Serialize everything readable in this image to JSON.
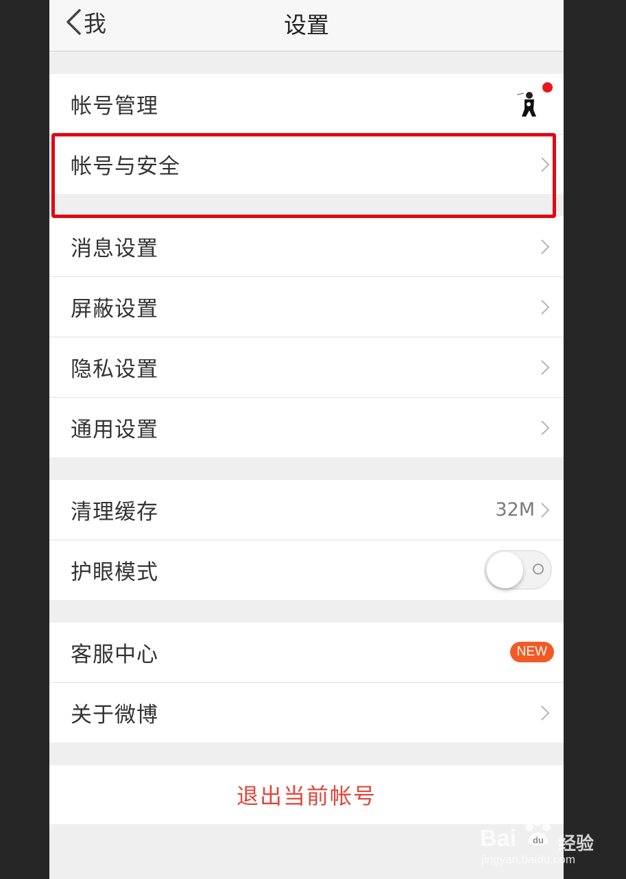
{
  "navbar": {
    "back_label": "我",
    "title": "设置"
  },
  "groups": {
    "account": [
      {
        "label": "帐号管理"
      },
      {
        "label": "帐号与安全"
      }
    ],
    "settings": [
      {
        "label": "消息设置"
      },
      {
        "label": "屏蔽设置"
      },
      {
        "label": "隐私设置"
      },
      {
        "label": "通用设置"
      }
    ],
    "tools": [
      {
        "label": "清理缓存",
        "value": "32M"
      },
      {
        "label": "护眼模式",
        "toggle": "off"
      }
    ],
    "support": [
      {
        "label": "客服中心",
        "badge": "NEW"
      },
      {
        "label": "关于微博"
      }
    ]
  },
  "logout_label": "退出当前帐号",
  "colors": {
    "accent_red": "#e2463a",
    "badge": "#f25a23",
    "highlight": "#e30613"
  },
  "watermark": {
    "brand": "Bai",
    "brand_suffix": "经验",
    "url": "jingyan.baidu.com"
  }
}
